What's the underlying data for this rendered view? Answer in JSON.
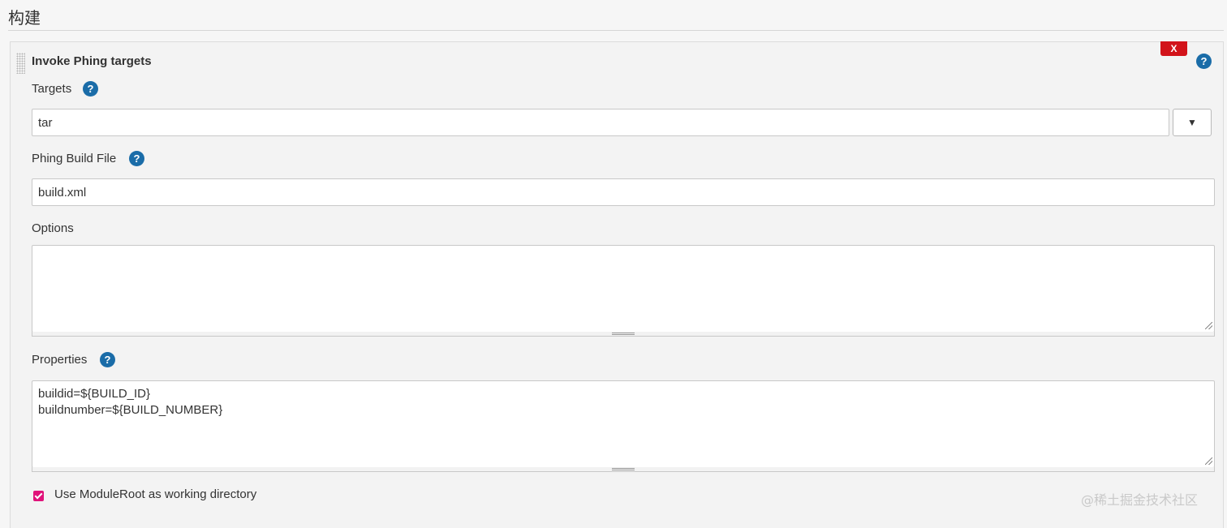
{
  "section": {
    "title": "构建"
  },
  "step": {
    "title": "Invoke Phing targets",
    "delete_label": "X",
    "help_glyph": "?"
  },
  "targets": {
    "label": "Targets",
    "value": "tar",
    "dropdown_glyph": "▼"
  },
  "build_file": {
    "label": "Phing Build File",
    "value": "build.xml"
  },
  "options": {
    "label": "Options",
    "value": ""
  },
  "properties": {
    "label": "Properties",
    "value": "buildid=${BUILD_ID}\nbuildnumber=${BUILD_NUMBER}"
  },
  "module_root": {
    "label": "Use ModuleRoot as working directory",
    "checked": true
  },
  "watermark": "@稀土掘金技术社区",
  "colors": {
    "help_icon": "#1a6ca8",
    "delete_button": "#d2131a",
    "checkbox": "#e0137a"
  },
  "icons": {
    "help": "question-circle-icon",
    "drag": "drag-handle-icon",
    "dropdown": "chevron-down-icon"
  }
}
